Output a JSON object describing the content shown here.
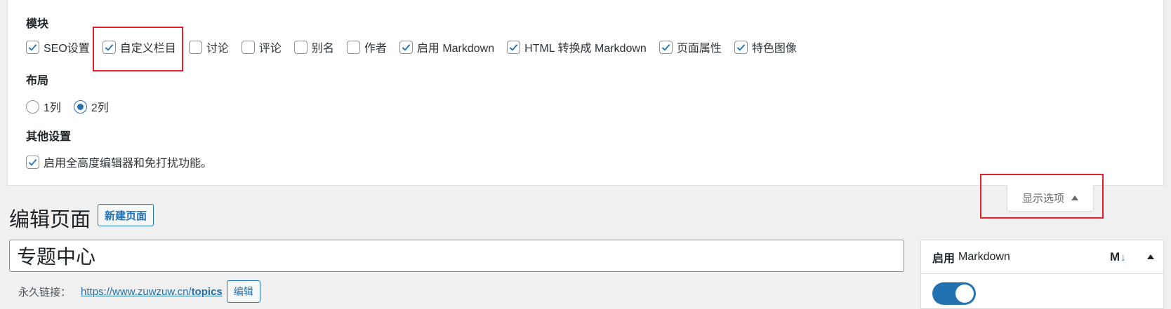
{
  "screen_options": {
    "modules_title": "模块",
    "modules": [
      {
        "label": "SEO设置",
        "checked": true
      },
      {
        "label": "自定义栏目",
        "checked": true
      },
      {
        "label": "讨论",
        "checked": false
      },
      {
        "label": "评论",
        "checked": false
      },
      {
        "label": "别名",
        "checked": false
      },
      {
        "label": "作者",
        "checked": false
      },
      {
        "label": "启用 Markdown",
        "checked": true
      },
      {
        "label": "HTML 转换成 Markdown",
        "checked": true
      },
      {
        "label": "页面属性",
        "checked": true
      },
      {
        "label": "特色图像",
        "checked": true
      }
    ],
    "layout_title": "布局",
    "layout_options": [
      {
        "label": "1列",
        "selected": false
      },
      {
        "label": "2列",
        "selected": true
      }
    ],
    "other_title": "其他设置",
    "other_option": {
      "label": "启用全高度编辑器和免打扰功能。",
      "checked": true
    },
    "toggle_label": "显示选项"
  },
  "page": {
    "title": "编辑页面",
    "add_new_label": "新建页面",
    "post_title": "专题中心",
    "permalink_label": "永久链接：",
    "permalink_base": "https://www.zuwzuw.cn/",
    "permalink_slug": "topics",
    "edit_label": "编辑"
  },
  "markdown_box": {
    "title_bold": "启用",
    "title_rest": "Markdown",
    "logo_m": "M",
    "logo_arrow": "↓",
    "enabled": true
  },
  "colors": {
    "accent": "#2271b1",
    "highlight_box": "#e0202a"
  }
}
